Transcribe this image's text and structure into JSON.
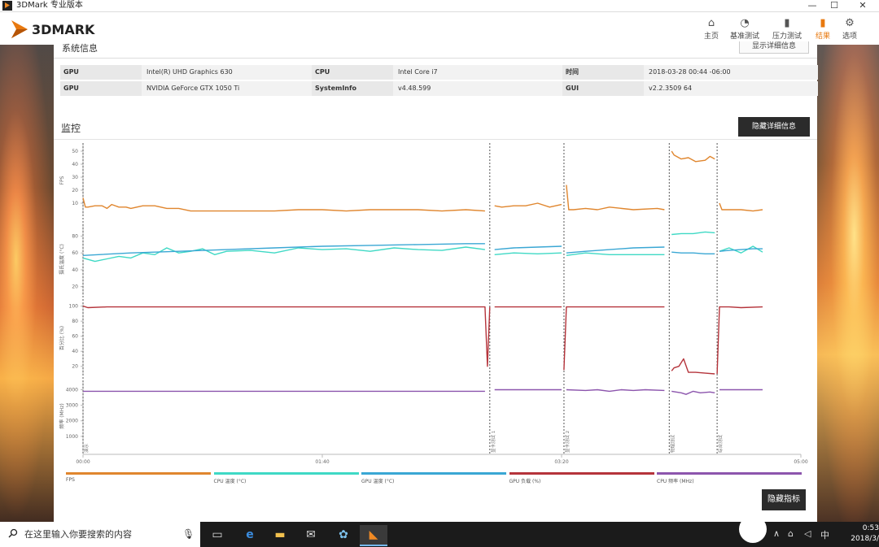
{
  "window": {
    "title": "3DMark 专业版本",
    "minimize": "—",
    "maximize": "☐",
    "close": "✕"
  },
  "nav": [
    {
      "icon": "home-icon",
      "glyph": "⌂",
      "label": "主页"
    },
    {
      "icon": "gauge-icon",
      "glyph": "◔",
      "label": "基准测试"
    },
    {
      "icon": "bars-icon",
      "glyph": "▮",
      "label": "压力测试"
    },
    {
      "icon": "results-icon",
      "glyph": "▮",
      "label": "结果"
    },
    {
      "icon": "gear-icon",
      "glyph": "⚙",
      "label": "选项"
    }
  ],
  "brand": {
    "name": "3DMARK",
    "accent": "#e8790f"
  },
  "system_info": {
    "title": "系统信息",
    "show_detail_label": "显示详细信息",
    "rows": [
      [
        {
          "k": "GPU",
          "v": "Intel(R) UHD Graphics 630"
        },
        {
          "k": "CPU",
          "v": "Intel Core i7"
        },
        {
          "k": "时间",
          "v": "2018-03-28 00:44 -06:00"
        }
      ],
      [
        {
          "k": "GPU",
          "v": "NVIDIA GeForce GTX 1050 Ti"
        },
        {
          "k": "SystemInfo",
          "v": "v4.48.599"
        },
        {
          "k": "GUI",
          "v": "v2.2.3509 64"
        }
      ]
    ]
  },
  "monitor": {
    "title": "监控",
    "hide_detail_label": "隐藏详细信息",
    "hide_metrics_label": "隐藏指标"
  },
  "chart_data": {
    "type": "line",
    "x_ticks": [
      "00:00",
      "01:40",
      "03:20",
      "05:00"
    ],
    "x_range_seconds": [
      0,
      300
    ],
    "segment_markers": [
      {
        "x": 0,
        "label": "演示"
      },
      {
        "x": 170,
        "label": "显卡测试 1"
      },
      {
        "x": 201,
        "label": "显卡测试 2"
      },
      {
        "x": 245,
        "label": "物理测试"
      },
      {
        "x": 265,
        "label": "综合测试"
      }
    ],
    "panels": [
      {
        "ylabel": "FPS",
        "yticks": [
          10,
          20,
          30,
          40,
          50
        ],
        "ylim": [
          0,
          55
        ]
      },
      {
        "ylabel": "摄氏温度 (°C)",
        "yticks": [
          20,
          40,
          60,
          80
        ],
        "ylim": [
          10,
          95
        ]
      },
      {
        "ylabel": "百分比 (%)",
        "yticks": [
          20,
          40,
          60,
          80,
          100
        ],
        "ylim": [
          10,
          105
        ]
      },
      {
        "ylabel": "频率 (MHz)",
        "yticks": [
          1000,
          2000,
          3000,
          4000
        ],
        "ylim": [
          0,
          4600
        ]
      }
    ],
    "series": [
      {
        "name": "FPS",
        "color": "#e0862e",
        "panel": 0,
        "segments": [
          {
            "x": [
              0,
              1,
              2,
              5,
              8,
              10,
              12,
              15,
              18,
              20,
              25,
              30,
              35,
              40,
              45,
              50,
              55,
              60,
              70,
              80,
              90,
              100,
              110,
              120,
              130,
              140,
              150,
              160,
              168
            ],
            "y": [
              14,
              7,
              7,
              8,
              8,
              6,
              9,
              7,
              7,
              6,
              8,
              8,
              6,
              6,
              4,
              4,
              4,
              4,
              4,
              4,
              5,
              5,
              4,
              5,
              5,
              5,
              4,
              5,
              4
            ]
          },
          {
            "x": [
              172,
              175,
              180,
              185,
              190,
              195,
              200
            ],
            "y": [
              8,
              7,
              8,
              8,
              10,
              7,
              9
            ]
          },
          {
            "x": [
              202,
              203,
              205,
              210,
              215,
              220,
              230,
              240,
              243
            ],
            "y": [
              24,
              5,
              5,
              6,
              5,
              7,
              5,
              6,
              5
            ]
          },
          {
            "x": [
              246,
              247,
              250,
              253,
              256,
              260,
              262,
              264
            ],
            "y": [
              50,
              47,
              44,
              45,
              42,
              43,
              46,
              44
            ]
          },
          {
            "x": [
              266,
              267,
              270,
              275,
              280,
              284
            ],
            "y": [
              10,
              5,
              5,
              5,
              4,
              5
            ]
          }
        ]
      },
      {
        "name": "CPU 温度 (°C)",
        "color": "#3fd9c5",
        "panel": 1,
        "segments": [
          {
            "x": [
              0,
              5,
              10,
              15,
              20,
              25,
              30,
              35,
              40,
              45,
              50,
              55,
              60,
              70,
              80,
              90,
              100,
              110,
              120,
              130,
              140,
              150,
              160,
              168
            ],
            "y": [
              54,
              50,
              53,
              56,
              54,
              60,
              58,
              66,
              60,
              62,
              65,
              58,
              62,
              63,
              60,
              66,
              64,
              65,
              62,
              66,
              64,
              63,
              67,
              64
            ]
          },
          {
            "x": [
              172,
              180,
              190,
              200
            ],
            "y": [
              58,
              60,
              59,
              60
            ]
          },
          {
            "x": [
              202,
              210,
              220,
              230,
              243
            ],
            "y": [
              57,
              60,
              58,
              58,
              58
            ]
          },
          {
            "x": [
              246,
              250,
              255,
              260,
              264
            ],
            "y": [
              82,
              83,
              83,
              85,
              84
            ]
          },
          {
            "x": [
              266,
              270,
              275,
              280,
              284
            ],
            "y": [
              62,
              66,
              60,
              68,
              61
            ]
          }
        ]
      },
      {
        "name": "GPU 温度 (°C)",
        "color": "#3aa7d4",
        "panel": 1,
        "segments": [
          {
            "x": [
              0,
              20,
              40,
              60,
              80,
              100,
              120,
              140,
              160,
              168
            ],
            "y": [
              57,
              60,
              62,
              64,
              66,
              68,
              69,
              70,
              71,
              71
            ]
          },
          {
            "x": [
              172,
              180,
              190,
              200
            ],
            "y": [
              64,
              66,
              67,
              68
            ]
          },
          {
            "x": [
              202,
              210,
              220,
              230,
              243
            ],
            "y": [
              60,
              62,
              64,
              66,
              67
            ]
          },
          {
            "x": [
              246,
              250,
              255,
              260,
              264
            ],
            "y": [
              61,
              60,
              60,
              59,
              59
            ]
          },
          {
            "x": [
              266,
              270,
              275,
              280,
              284
            ],
            "y": [
              62,
              63,
              64,
              65,
              65
            ]
          }
        ]
      },
      {
        "name": "GPU 负载 (%)",
        "color": "#b5343b",
        "panel": 2,
        "segments": [
          {
            "x": [
              0,
              2,
              10,
              30,
              60,
              90,
              120,
              150,
              168,
              169,
              170
            ],
            "y": [
              100,
              98,
              99,
              99,
              99,
              99,
              99,
              99,
              99,
              20,
              99
            ]
          },
          {
            "x": [
              172,
              175,
              180,
              190,
              200
            ],
            "y": [
              99,
              99,
              99,
              99,
              99
            ]
          },
          {
            "x": [
              201,
              202,
              203,
              210,
              220,
              230,
              243
            ],
            "y": [
              15,
              99,
              99,
              99,
              99,
              99,
              99
            ]
          },
          {
            "x": [
              246,
              247,
              249,
              251,
              253,
              256,
              260,
              264
            ],
            "y": [
              14,
              18,
              20,
              30,
              12,
              12,
              11,
              10
            ]
          },
          {
            "x": [
              265,
              266,
              270,
              275,
              284
            ],
            "y": [
              10,
              99,
              99,
              98,
              99
            ]
          }
        ]
      },
      {
        "name": "CPU 频率 (MHz)",
        "color": "#8c55ad",
        "panel": 3,
        "segments": [
          {
            "x": [
              0,
              30,
              60,
              90,
              120,
              150,
              168
            ],
            "y": [
              3900,
              3900,
              3900,
              3900,
              3900,
              3900,
              3900
            ]
          },
          {
            "x": [
              172,
              180,
              190,
              200
            ],
            "y": [
              4000,
              4000,
              4000,
              4000
            ]
          },
          {
            "x": [
              202,
              210,
              215,
              220,
              225,
              230,
              235,
              243
            ],
            "y": [
              4000,
              3950,
              4000,
              3900,
              4000,
              3950,
              4000,
              3950
            ]
          },
          {
            "x": [
              246,
              250,
              252,
              255,
              258,
              262,
              264
            ],
            "y": [
              3900,
              3800,
              3700,
              3900,
              3800,
              3850,
              3800
            ]
          },
          {
            "x": [
              266,
              270,
              275,
              284
            ],
            "y": [
              4000,
              4000,
              4000,
              4000
            ]
          }
        ]
      }
    ],
    "legend": [
      "FPS",
      "CPU 温度 (°C)",
      "GPU 温度 (°C)",
      "GPU 负载 (%)",
      "CPU 频率 (MHz)"
    ],
    "legend_colors": [
      "#e0862e",
      "#3fd9c5",
      "#3aa7d4",
      "#b5343b",
      "#8c55ad"
    ]
  },
  "taskbar": {
    "search_placeholder": "在这里输入你要搜索的内容",
    "time": "0:53",
    "date": "2018/3/"
  }
}
